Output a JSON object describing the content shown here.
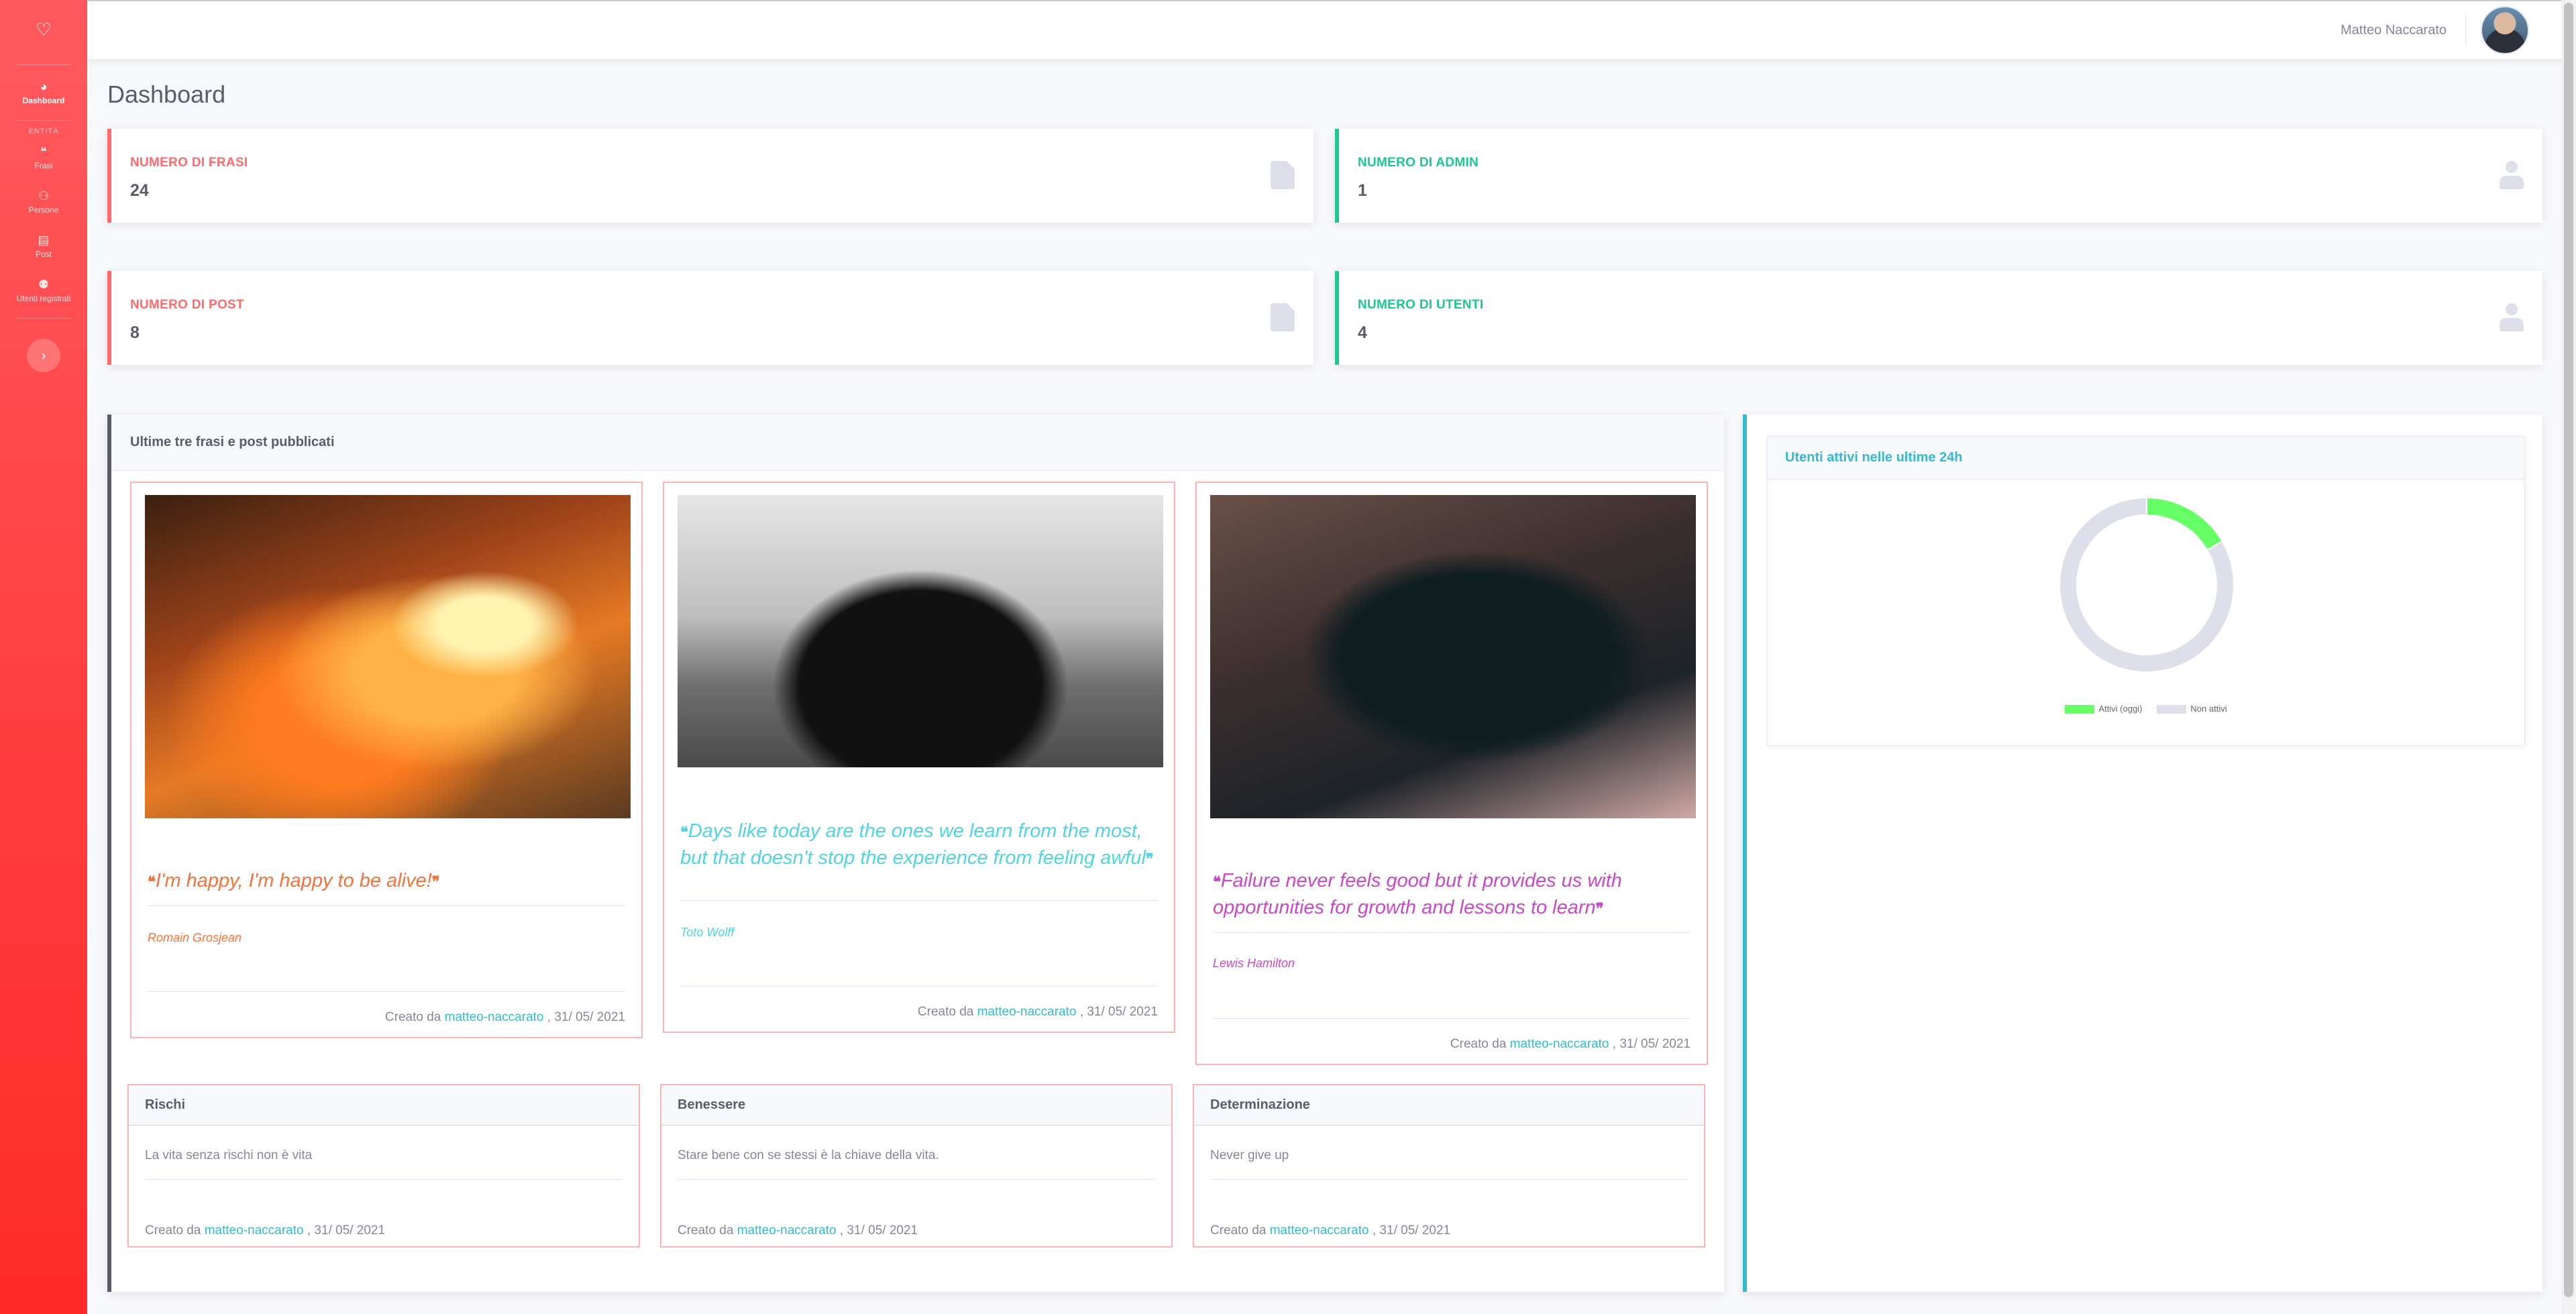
{
  "sidebar": {
    "brand_icon": "heart-outline-icon",
    "items": [
      {
        "label": "Dashboard",
        "icon": "tachometer-icon"
      },
      {
        "label": "Frasi",
        "icon": "quote-icon"
      },
      {
        "label": "Persone",
        "icon": "users-cog-icon"
      },
      {
        "label": "Post",
        "icon": "file-icon"
      },
      {
        "label": "Utenti registrati",
        "icon": "users-icon"
      }
    ],
    "heading": "ENTITÀ",
    "toggle": "›"
  },
  "topbar": {
    "user_name": "Matteo Naccarato"
  },
  "page_title": "Dashboard",
  "stats": {
    "frasi": {
      "label": "NUMERO DI FRASI",
      "value": "24"
    },
    "admin": {
      "label": "NUMERO DI ADMIN",
      "value": "1"
    },
    "post": {
      "label": "NUMERO DI POST",
      "value": "8"
    },
    "utenti": {
      "label": "NUMERO DI UTENTI",
      "value": "4"
    }
  },
  "recent": {
    "title": "Ultime tre frasi e post pubblicati",
    "posts": [
      {
        "quote": "I'm happy, I'm happy to be alive!",
        "author": "Romain Grosjean",
        "color": "#f5733b",
        "created_prefix": "Creato da",
        "created_user": "matteo-naccarato",
        "created_date": ", 31/ 05/ 2021"
      },
      {
        "quote": "Days like today are the ones we learn from the most, but that doesn't stop the experience from feeling awful",
        "author": "Toto Wolff",
        "color": "#4fd4e6",
        "created_prefix": "Creato da",
        "created_user": "matteo-naccarato",
        "created_date": ", 31/ 05/ 2021"
      },
      {
        "quote": "Failure never feels good but it provides us with opportunities for growth and lessons to learn",
        "author": "Lewis Hamilton",
        "color": "#c848c8",
        "created_prefix": "Creato da",
        "created_user": "matteo-naccarato",
        "created_date": ", 31/ 05/ 2021"
      }
    ],
    "phrases": [
      {
        "title": "Rischi",
        "text": "La vita senza rischi non è vita",
        "created_prefix": "Creato da",
        "created_user": "matteo-naccarato",
        "created_date": ", 31/ 05/ 2021"
      },
      {
        "title": "Benessere",
        "text": "Stare bene con se stessi è la chiave della vita.",
        "created_prefix": "Creato da",
        "created_user": "matteo-naccarato",
        "created_date": ", 31/ 05/ 2021"
      },
      {
        "title": "Determinazione",
        "text": "Never give up",
        "created_prefix": "Creato da",
        "created_user": "matteo-naccarato",
        "created_date": ", 31/ 05/ 2021"
      }
    ]
  },
  "active_users": {
    "title": "Utenti attivi nelle ultime 24h",
    "legend": [
      {
        "label": "Attivi (oggi)",
        "color": "#66ff66"
      },
      {
        "label": "Non attivi",
        "color": "#dddfeb"
      }
    ]
  },
  "chart_data": {
    "type": "pie",
    "title": "",
    "labels": [
      "Attivi (oggi)",
      "Non attivi"
    ],
    "values": [
      1,
      5
    ],
    "colors": [
      "#66ff66",
      "#dddfeb"
    ],
    "donut": true,
    "legend": "bottom"
  },
  "colors": {
    "accent": "#ff4d4d",
    "success": "#1cc88a",
    "info": "#36b9cc"
  }
}
